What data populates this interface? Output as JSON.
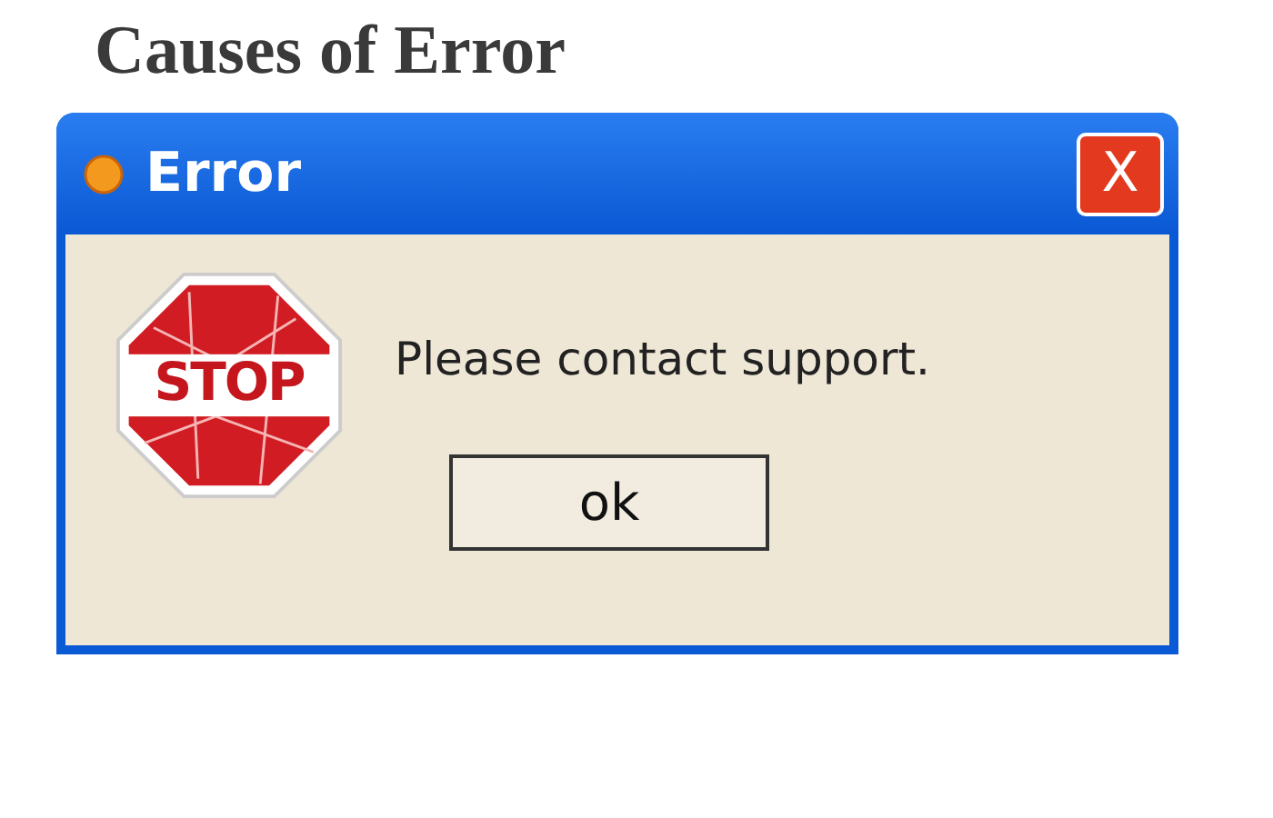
{
  "heading": "Causes of Error",
  "window": {
    "title": "Error",
    "close": "X"
  },
  "stop_sign": {
    "text": "STOP"
  },
  "message": "Please contact support.",
  "buttons": [
    "ok"
  ]
}
